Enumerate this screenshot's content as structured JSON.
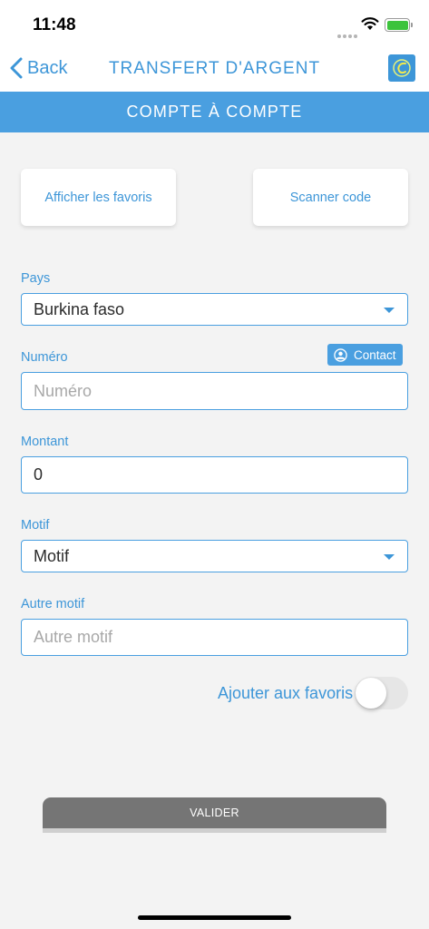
{
  "status_bar": {
    "time": "11:48"
  },
  "nav": {
    "back_label": "Back",
    "title": "TRANSFERT D'ARGENT"
  },
  "banner": {
    "title": "COMPTE À COMPTE"
  },
  "actions": {
    "favorites_label": "Afficher les favoris",
    "scan_label": "Scanner code"
  },
  "form": {
    "pays": {
      "label": "Pays",
      "value": "Burkina faso"
    },
    "numero": {
      "label": "Numéro",
      "placeholder": "Numéro",
      "contact_label": "Contact"
    },
    "montant": {
      "label": "Montant",
      "value": "0"
    },
    "motif": {
      "label": "Motif",
      "value": "Motif"
    },
    "autre_motif": {
      "label": "Autre motif",
      "placeholder": "Autre motif"
    },
    "add_favorites": {
      "label": "Ajouter aux favoris",
      "enabled": false
    }
  },
  "submit": {
    "label": "VALIDER"
  },
  "colors": {
    "accent": "#4a9fe0",
    "text_accent": "#3d96d8",
    "button_disabled": "#757575"
  },
  "icons": [
    "wifi-icon",
    "battery-icon",
    "chevron-left-icon",
    "app-logo-icon",
    "caret-down-icon",
    "person-circle-icon"
  ]
}
